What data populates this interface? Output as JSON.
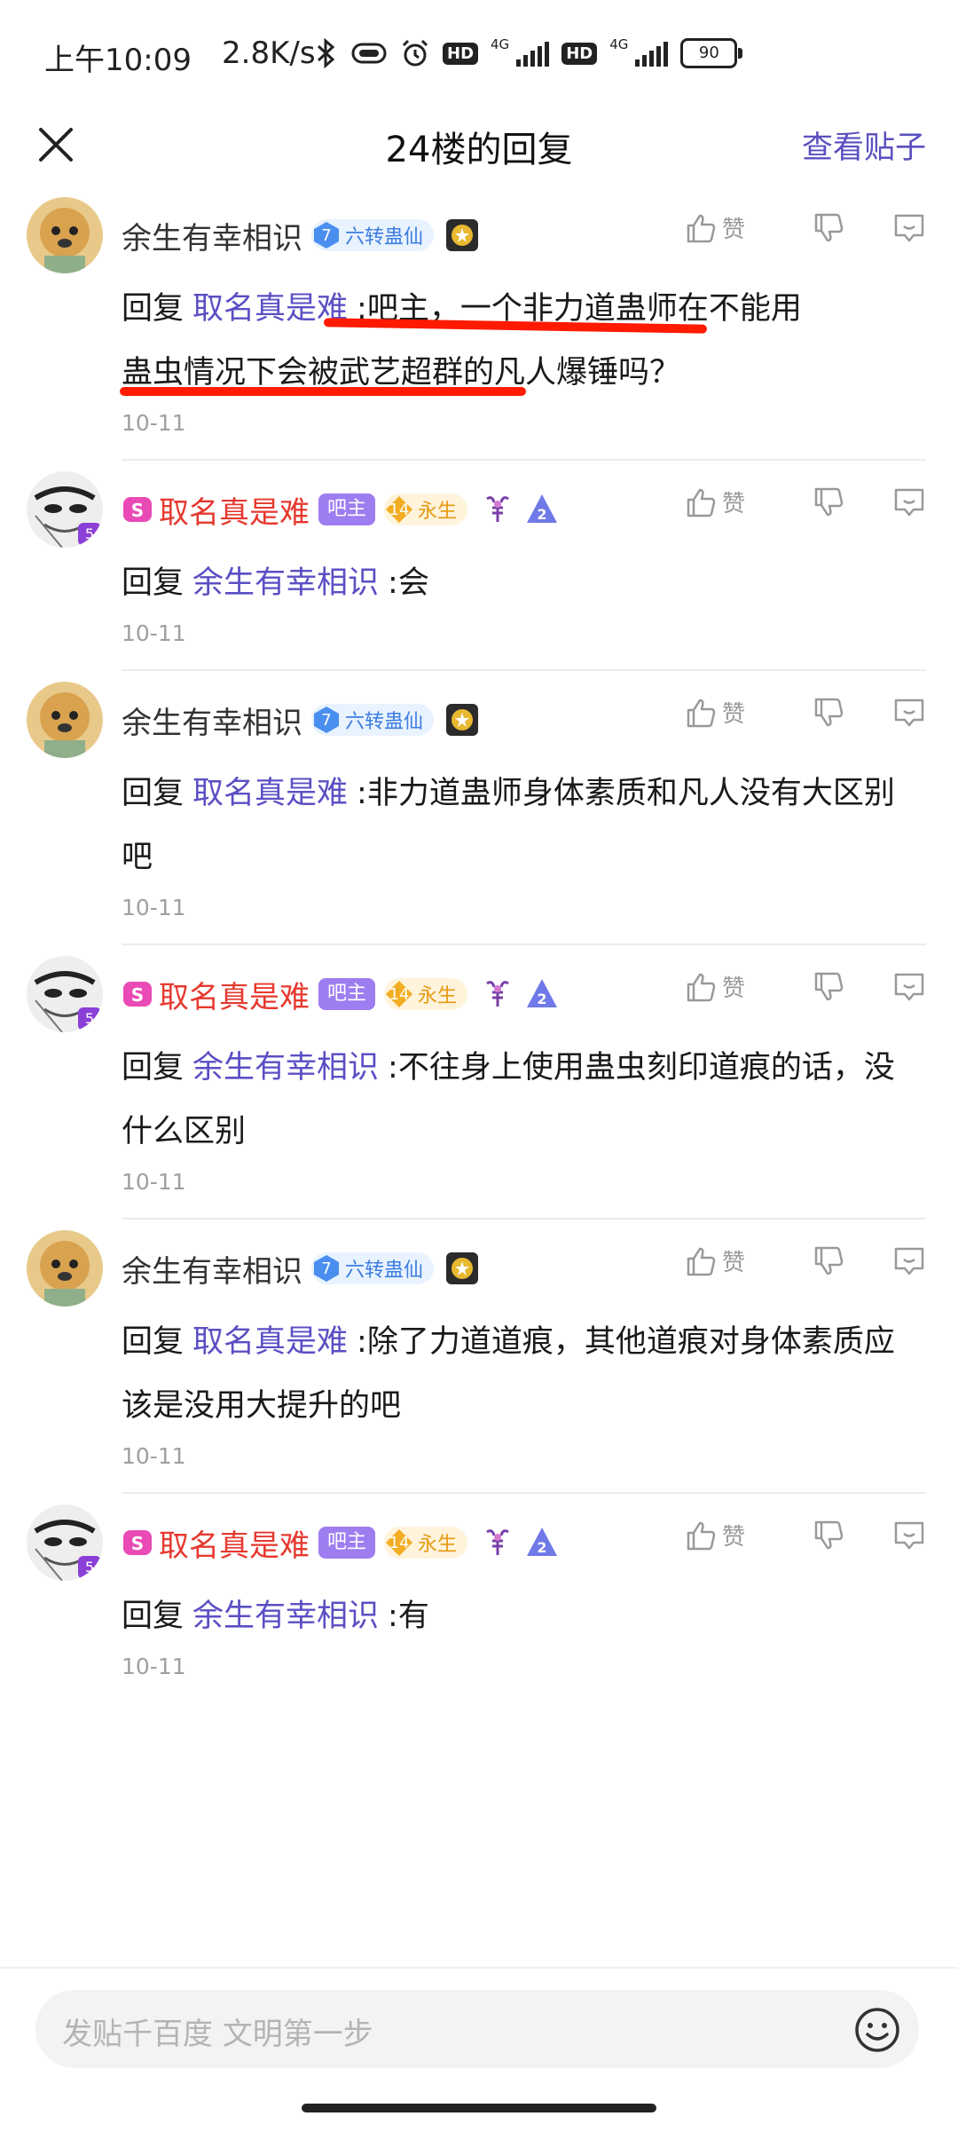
{
  "status_bar": {
    "time": "上午10:09",
    "speed": "2.8K/s",
    "hd1": "HD",
    "hd2": "HD",
    "net1": "4G",
    "net2": "4G",
    "battery": "90"
  },
  "header": {
    "title": "24楼的回复",
    "view_post": "查看贴子"
  },
  "badges": {
    "user_a_level": "7",
    "user_a_title": "六转蛊仙",
    "user_b_admin": "吧主",
    "user_b_level": "14",
    "user_b_title": "永生",
    "user_b_avatar_level": "5"
  },
  "actions": {
    "like_label": "赞"
  },
  "replies": [
    {
      "user": "余生有幸相识",
      "reply_word": "回复",
      "reply_to": "取名真是难",
      "text": ":吧主，一个非力道蛊师在不能用蛊虫情况下会被武艺超群的凡人爆锤吗？",
      "text_a": ":吧主，",
      "text_b": "一个非力道蛊师在不能用",
      "text_c": "蛊虫情况下会被武艺超群的凡人爆锤吗？",
      "date": "10-11"
    },
    {
      "user": "取名真是难",
      "reply_word": "回复",
      "reply_to": "余生有幸相识",
      "text": ":会",
      "date": "10-11"
    },
    {
      "user": "余生有幸相识",
      "reply_word": "回复",
      "reply_to": "取名真是难",
      "text": ":非力道蛊师身体素质和凡人没有大区别吧",
      "date": "10-11"
    },
    {
      "user": "取名真是难",
      "reply_word": "回复",
      "reply_to": "余生有幸相识",
      "text": ":不往身上使用蛊虫刻印道痕的话，没什么区别",
      "date": "10-11"
    },
    {
      "user": "余生有幸相识",
      "reply_word": "回复",
      "reply_to": "取名真是难",
      "text": ":除了力道道痕，其他道痕对身体素质应该是没用大提升的吧",
      "date": "10-11"
    },
    {
      "user": "取名真是难",
      "reply_word": "回复",
      "reply_to": "余生有幸相识",
      "text": ":有",
      "date": "10-11"
    }
  ],
  "bottom": {
    "input_placeholder": "发贴千百度 文明第一步"
  }
}
